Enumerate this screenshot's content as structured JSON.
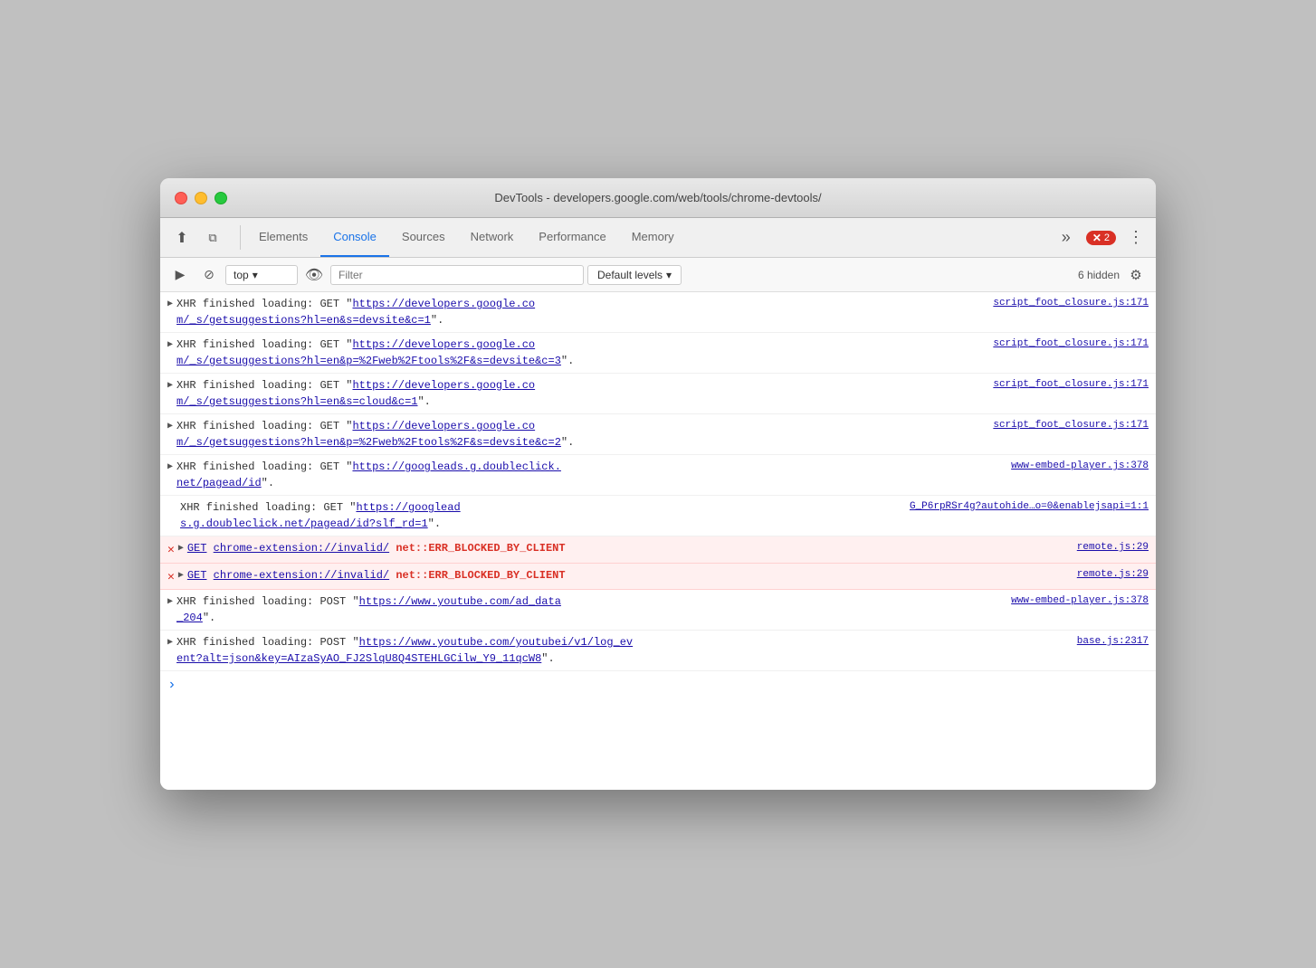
{
  "window": {
    "title": "DevTools - developers.google.com/web/tools/chrome-devtools/"
  },
  "tabs_bar": {
    "cursor_icon": "⬆",
    "layers_icon": "⧉",
    "tabs": [
      {
        "id": "elements",
        "label": "Elements",
        "active": false
      },
      {
        "id": "console",
        "label": "Console",
        "active": true
      },
      {
        "id": "sources",
        "label": "Sources",
        "active": false
      },
      {
        "id": "network",
        "label": "Network",
        "active": false
      },
      {
        "id": "performance",
        "label": "Performance",
        "active": false
      },
      {
        "id": "memory",
        "label": "Memory",
        "active": false
      }
    ],
    "more_label": "»",
    "error_count": "2",
    "kebab_label": "⋮"
  },
  "console_toolbar": {
    "run_icon": "▶",
    "block_icon": "⊘",
    "context_value": "top",
    "context_arrow": "▾",
    "eye_icon": "👁",
    "filter_placeholder": "Filter",
    "levels_label": "Default levels",
    "levels_arrow": "▾",
    "hidden_label": "6 hidden",
    "settings_icon": "⚙"
  },
  "log_entries": [
    {
      "id": 1,
      "type": "info",
      "toggle": "▶",
      "content": "XHR finished loading: GET \"https://developers.google.co\nm/_s/getsuggestions?hl=en&s=devsite&c=1\".",
      "source": "script_foot_closure.js:171"
    },
    {
      "id": 2,
      "type": "info",
      "toggle": "▶",
      "content": "XHR finished loading: GET \"https://developers.google.co\nm/_s/getsuggestions?hl=en&p=%2Fweb%2Ftools%2F&s=devsite&c=3\".",
      "source": "script_foot_closure.js:171"
    },
    {
      "id": 3,
      "type": "info",
      "toggle": "▶",
      "content": "XHR finished loading: GET \"https://developers.google.co\nm/_s/getsuggestions?hl=en&s=cloud&c=1\".",
      "source": "script_foot_closure.js:171"
    },
    {
      "id": 4,
      "type": "info",
      "toggle": "▶",
      "content": "XHR finished loading: GET \"https://developers.google.co\nm/_s/getsuggestions?hl=en&p=%2Fweb%2Ftools%2F&s=devsite&c=2\".",
      "source": "script_foot_closure.js:171"
    },
    {
      "id": 5,
      "type": "info",
      "toggle": "▶",
      "content": "XHR finished loading: GET \"https://googleads.g.doubleclick.\nnet/pagead/id\".",
      "source": "www-embed-player.js:378"
    },
    {
      "id": 6,
      "type": "info",
      "toggle": null,
      "content": "XHR finished loading: GET \"https://googlead\ns.g.doubleclick.net/pagead/id?slf_rd=1\".",
      "source": "G_P6rpRSr4g?autohide…o=0&enablejsapi=1:1"
    },
    {
      "id": 7,
      "type": "error",
      "toggle": "▶",
      "get_label": "GET",
      "get_url": "chrome-extension://invalid/",
      "err_msg": "net::ERR_BLOCKED_BY_CLIENT",
      "source": "remote.js:29"
    },
    {
      "id": 8,
      "type": "error",
      "toggle": "▶",
      "get_label": "GET",
      "get_url": "chrome-extension://invalid/",
      "err_msg": "net::ERR_BLOCKED_BY_CLIENT",
      "source": "remote.js:29"
    },
    {
      "id": 9,
      "type": "info",
      "toggle": "▶",
      "content": "XHR finished loading: POST \"https://www.youtube.com/ad_data\n_204\".",
      "source": "www-embed-player.js:378"
    },
    {
      "id": 10,
      "type": "info",
      "toggle": "▶",
      "content": "XHR finished loading: POST \"https://www.youtube.com/youtubei/v1/log_ev\nent?alt=json&key=AIzaSyAO_FJ2SlqU8Q4STEHLGCilw_Y9_11qcW8\".",
      "source": "base.js:2317"
    }
  ]
}
